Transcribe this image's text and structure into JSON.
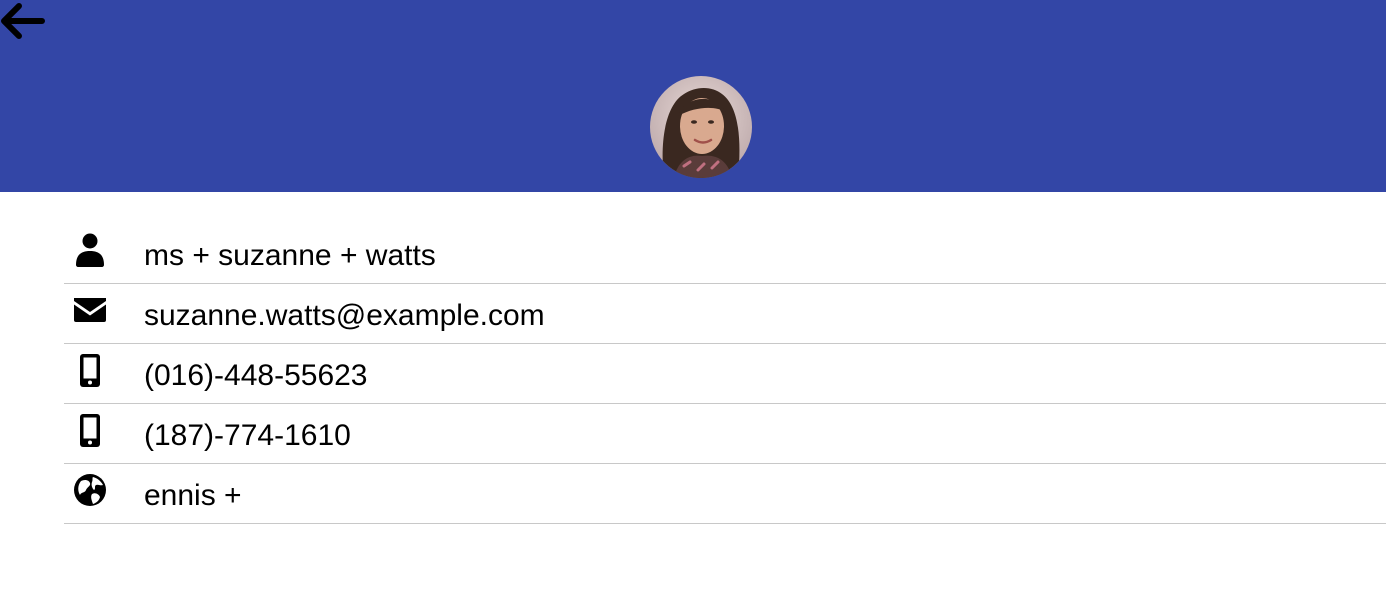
{
  "header": {
    "background_color": "#3346a6",
    "back_icon": "arrow-left-icon",
    "avatar_icon": "profile-photo"
  },
  "contact": {
    "rows": [
      {
        "icon": "person-icon",
        "text": "ms + suzanne + watts"
      },
      {
        "icon": "envelope-icon",
        "text": "suzanne.watts@example.com"
      },
      {
        "icon": "mobile-phone-icon",
        "text": "(016)-448-55623"
      },
      {
        "icon": "mobile-phone-icon",
        "text": "(187)-774-1610"
      },
      {
        "icon": "globe-icon",
        "text": "ennis +"
      }
    ]
  }
}
